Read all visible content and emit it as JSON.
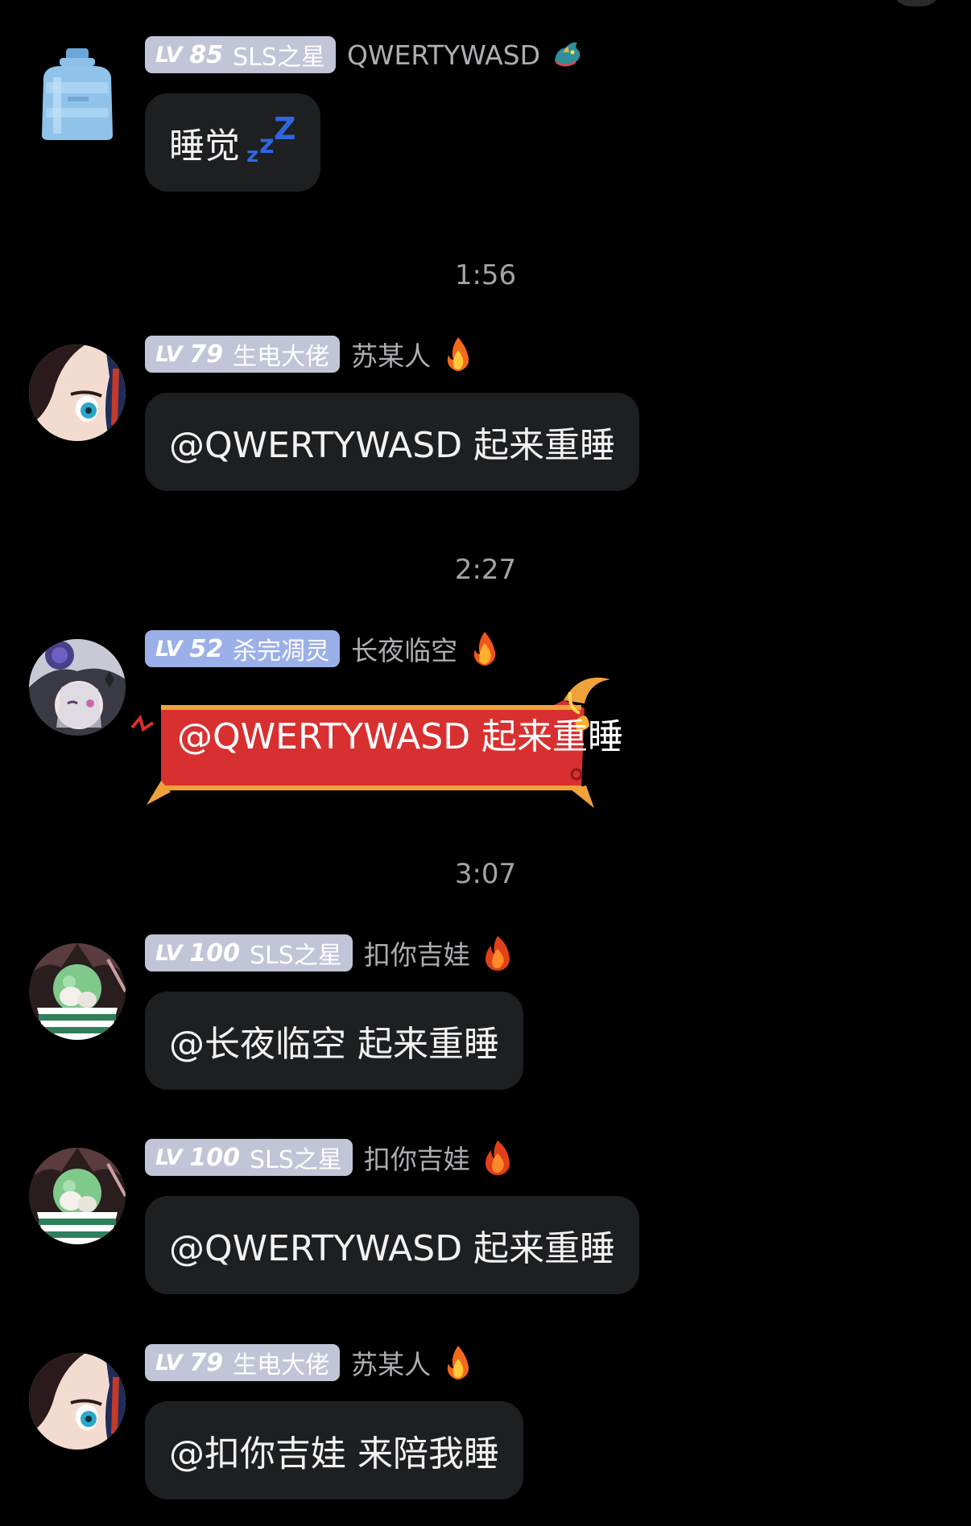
{
  "timestamps": [
    "1:56",
    "2:27",
    "3:07"
  ],
  "messages": [
    {
      "level_prefix": "LV",
      "level": "85",
      "badge_title": "SLS之星",
      "sender": "QWERTYWASD",
      "tag_icon": "dragon-icon",
      "text": "睡觉",
      "sticker": [
        "z",
        "z",
        "Z"
      ]
    },
    {
      "level_prefix": "LV",
      "level": "79",
      "badge_title": "生电大佬",
      "sender": "苏某人",
      "tag_icon": "fire-icon",
      "text": "@QWERTYWASD 起来重睡"
    },
    {
      "level_prefix": "LV",
      "level": "52",
      "badge_title": "杀完凋灵",
      "sender": "长夜临空",
      "tag_icon": "fire-icon",
      "text": "@QWERTYWASD 起来重睡",
      "bubble_style": "red-devil-frame"
    },
    {
      "level_prefix": "LV",
      "level": "100",
      "badge_title": "SLS之星",
      "sender": "扣你吉娃",
      "tag_icon": "fire-icon",
      "text": "@长夜临空 起来重睡"
    },
    {
      "level_prefix": "LV",
      "level": "100",
      "badge_title": "SLS之星",
      "sender": "扣你吉娃",
      "tag_icon": "fire-icon",
      "text": "@QWERTYWASD 起来重睡"
    },
    {
      "level_prefix": "LV",
      "level": "79",
      "badge_title": "生电大佬",
      "sender": "苏某人",
      "tag_icon": "fire-icon",
      "text": "@扣你吉娃 来陪我睡"
    }
  ],
  "colors": {
    "background": "#000000",
    "bubble": "#1e1f21",
    "badge_gray": "#c2c5d7",
    "badge_blue": "#9bb0e9",
    "timestamp": "#a3a3a8",
    "sender_name": "#aeaeb2",
    "red_bubble": "#d83030",
    "zzz": "#2f66e0"
  }
}
